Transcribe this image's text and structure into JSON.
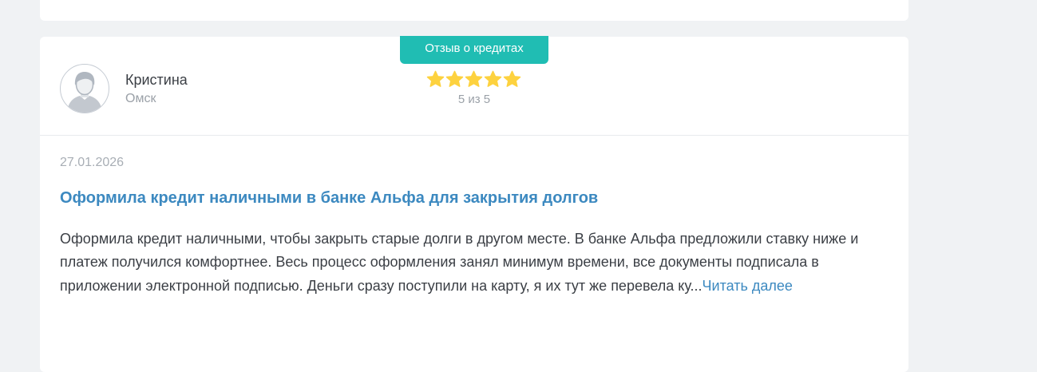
{
  "review": {
    "category_badge": "Отзыв о кредитах",
    "author": {
      "name": "Кристина",
      "city": "Омск"
    },
    "rating": {
      "value": 5,
      "max": 5,
      "text": "5 из 5"
    },
    "date": "27.01.2026",
    "title": "Оформила кредит наличными в банке Альфа для закрытия долгов",
    "body": "Оформила кредит наличными, чтобы закрыть старые долги в другом месте. В банке Альфа предложили ставку ниже и платеж получился комфортнее. Весь процесс оформления занял минимум времени, все документы подписала в приложении электронной подписью. Деньги сразу поступили на карту, я их тут же перевела ку...",
    "read_more": "Читать далее"
  },
  "icons": {
    "avatar": "user-avatar-icon",
    "star": "star-icon"
  },
  "colors": {
    "page_background": "#f0f2f4",
    "card_background": "#ffffff",
    "badge_background": "#20bdb3",
    "star": "#fdd23f",
    "link": "#3c89c0",
    "text": "#3b3f45",
    "muted_text": "#9ba1a8"
  }
}
